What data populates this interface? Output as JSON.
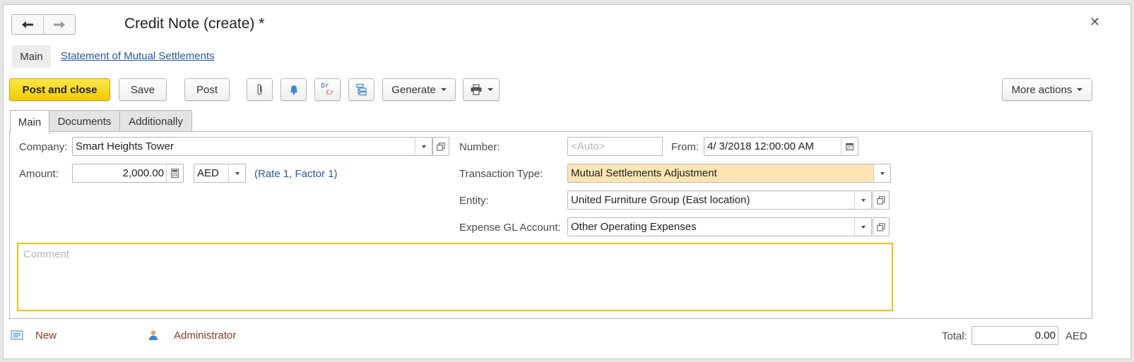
{
  "window": {
    "title": "Credit Note (create) *"
  },
  "sections": {
    "main": "Main",
    "statement_link": "Statement of Mutual Settlements"
  },
  "toolbar": {
    "post_and_close": "Post and close",
    "save": "Save",
    "post": "Post",
    "dr_label": "Dr",
    "cr_label": "Cr",
    "generate": "Generate",
    "more_actions": "More actions"
  },
  "tabs": [
    {
      "label": "Main",
      "active": true
    },
    {
      "label": "Documents",
      "active": false
    },
    {
      "label": "Additionally",
      "active": false
    }
  ],
  "form": {
    "company_label": "Company:",
    "company_value": "Smart Heights Tower",
    "amount_label": "Amount:",
    "amount_value": "2,000.00",
    "currency_value": "AED",
    "rate_link": "(Rate 1, Factor 1)",
    "number_label": "Number:",
    "number_placeholder": "<Auto>",
    "from_label": "From:",
    "from_value": "4/ 3/2018 12:00:00 AM",
    "transaction_type_label": "Transaction Type:",
    "transaction_type_value": "Mutual Settlements Adjustment",
    "entity_label": "Entity:",
    "entity_value": "United Furniture Group (East location)",
    "expense_gl_label": "Expense GL Account:",
    "expense_gl_value": "Other Operating Expenses",
    "comment_placeholder": "Comment"
  },
  "footer": {
    "status": "New",
    "user": "Administrator",
    "total_label": "Total:",
    "total_value": "0.00",
    "total_currency": "AED"
  },
  "colors": {
    "primary_button": "#f5d313",
    "link": "#2857a5",
    "highlight_field": "#fde5b4",
    "comment_border": "#f2c200",
    "footer_text": "#8b3a1c"
  }
}
